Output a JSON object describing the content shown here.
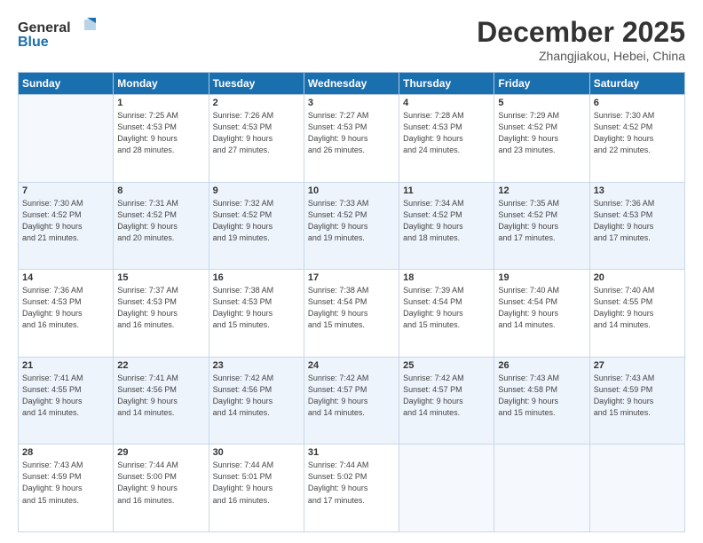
{
  "header": {
    "logo_line1": "General",
    "logo_line2": "Blue",
    "month": "December 2025",
    "location": "Zhangjiakou, Hebei, China"
  },
  "weekdays": [
    "Sunday",
    "Monday",
    "Tuesday",
    "Wednesday",
    "Thursday",
    "Friday",
    "Saturday"
  ],
  "weeks": [
    [
      {
        "day": "",
        "info": ""
      },
      {
        "day": "1",
        "info": "Sunrise: 7:25 AM\nSunset: 4:53 PM\nDaylight: 9 hours\nand 28 minutes."
      },
      {
        "day": "2",
        "info": "Sunrise: 7:26 AM\nSunset: 4:53 PM\nDaylight: 9 hours\nand 27 minutes."
      },
      {
        "day": "3",
        "info": "Sunrise: 7:27 AM\nSunset: 4:53 PM\nDaylight: 9 hours\nand 26 minutes."
      },
      {
        "day": "4",
        "info": "Sunrise: 7:28 AM\nSunset: 4:53 PM\nDaylight: 9 hours\nand 24 minutes."
      },
      {
        "day": "5",
        "info": "Sunrise: 7:29 AM\nSunset: 4:52 PM\nDaylight: 9 hours\nand 23 minutes."
      },
      {
        "day": "6",
        "info": "Sunrise: 7:30 AM\nSunset: 4:52 PM\nDaylight: 9 hours\nand 22 minutes."
      }
    ],
    [
      {
        "day": "7",
        "info": "Sunrise: 7:30 AM\nSunset: 4:52 PM\nDaylight: 9 hours\nand 21 minutes."
      },
      {
        "day": "8",
        "info": "Sunrise: 7:31 AM\nSunset: 4:52 PM\nDaylight: 9 hours\nand 20 minutes."
      },
      {
        "day": "9",
        "info": "Sunrise: 7:32 AM\nSunset: 4:52 PM\nDaylight: 9 hours\nand 19 minutes."
      },
      {
        "day": "10",
        "info": "Sunrise: 7:33 AM\nSunset: 4:52 PM\nDaylight: 9 hours\nand 19 minutes."
      },
      {
        "day": "11",
        "info": "Sunrise: 7:34 AM\nSunset: 4:52 PM\nDaylight: 9 hours\nand 18 minutes."
      },
      {
        "day": "12",
        "info": "Sunrise: 7:35 AM\nSunset: 4:52 PM\nDaylight: 9 hours\nand 17 minutes."
      },
      {
        "day": "13",
        "info": "Sunrise: 7:36 AM\nSunset: 4:53 PM\nDaylight: 9 hours\nand 17 minutes."
      }
    ],
    [
      {
        "day": "14",
        "info": "Sunrise: 7:36 AM\nSunset: 4:53 PM\nDaylight: 9 hours\nand 16 minutes."
      },
      {
        "day": "15",
        "info": "Sunrise: 7:37 AM\nSunset: 4:53 PM\nDaylight: 9 hours\nand 16 minutes."
      },
      {
        "day": "16",
        "info": "Sunrise: 7:38 AM\nSunset: 4:53 PM\nDaylight: 9 hours\nand 15 minutes."
      },
      {
        "day": "17",
        "info": "Sunrise: 7:38 AM\nSunset: 4:54 PM\nDaylight: 9 hours\nand 15 minutes."
      },
      {
        "day": "18",
        "info": "Sunrise: 7:39 AM\nSunset: 4:54 PM\nDaylight: 9 hours\nand 15 minutes."
      },
      {
        "day": "19",
        "info": "Sunrise: 7:40 AM\nSunset: 4:54 PM\nDaylight: 9 hours\nand 14 minutes."
      },
      {
        "day": "20",
        "info": "Sunrise: 7:40 AM\nSunset: 4:55 PM\nDaylight: 9 hours\nand 14 minutes."
      }
    ],
    [
      {
        "day": "21",
        "info": "Sunrise: 7:41 AM\nSunset: 4:55 PM\nDaylight: 9 hours\nand 14 minutes."
      },
      {
        "day": "22",
        "info": "Sunrise: 7:41 AM\nSunset: 4:56 PM\nDaylight: 9 hours\nand 14 minutes."
      },
      {
        "day": "23",
        "info": "Sunrise: 7:42 AM\nSunset: 4:56 PM\nDaylight: 9 hours\nand 14 minutes."
      },
      {
        "day": "24",
        "info": "Sunrise: 7:42 AM\nSunset: 4:57 PM\nDaylight: 9 hours\nand 14 minutes."
      },
      {
        "day": "25",
        "info": "Sunrise: 7:42 AM\nSunset: 4:57 PM\nDaylight: 9 hours\nand 14 minutes."
      },
      {
        "day": "26",
        "info": "Sunrise: 7:43 AM\nSunset: 4:58 PM\nDaylight: 9 hours\nand 15 minutes."
      },
      {
        "day": "27",
        "info": "Sunrise: 7:43 AM\nSunset: 4:59 PM\nDaylight: 9 hours\nand 15 minutes."
      }
    ],
    [
      {
        "day": "28",
        "info": "Sunrise: 7:43 AM\nSunset: 4:59 PM\nDaylight: 9 hours\nand 15 minutes."
      },
      {
        "day": "29",
        "info": "Sunrise: 7:44 AM\nSunset: 5:00 PM\nDaylight: 9 hours\nand 16 minutes."
      },
      {
        "day": "30",
        "info": "Sunrise: 7:44 AM\nSunset: 5:01 PM\nDaylight: 9 hours\nand 16 minutes."
      },
      {
        "day": "31",
        "info": "Sunrise: 7:44 AM\nSunset: 5:02 PM\nDaylight: 9 hours\nand 17 minutes."
      },
      {
        "day": "",
        "info": ""
      },
      {
        "day": "",
        "info": ""
      },
      {
        "day": "",
        "info": ""
      }
    ]
  ]
}
